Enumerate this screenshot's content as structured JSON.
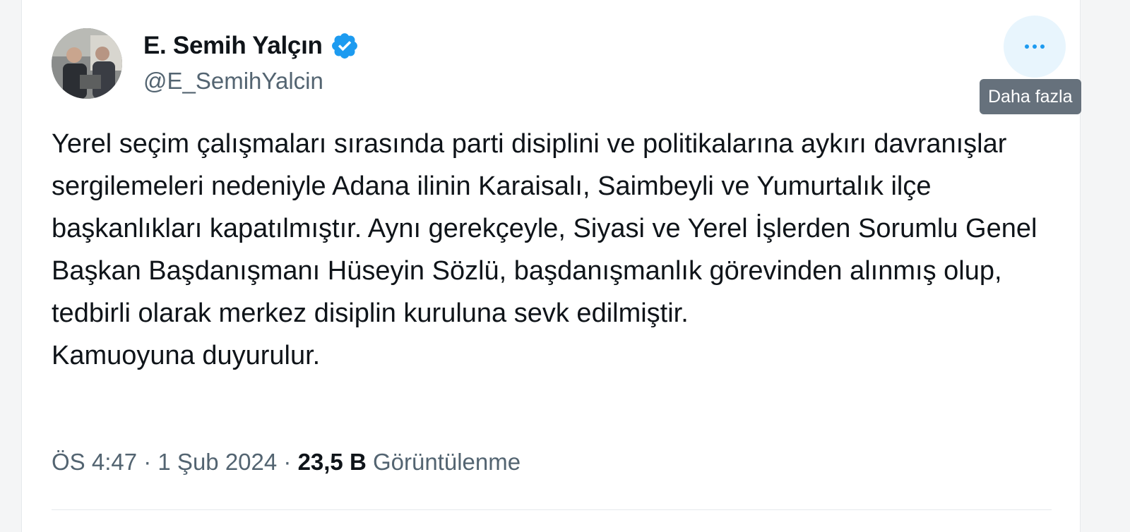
{
  "author": {
    "display_name": "E. Semih Yalçın",
    "handle": "@E_SemihYalcin",
    "verified_icon": "verified-badge-icon",
    "verified_color": "#1d9bf0"
  },
  "more_button": {
    "icon": "more-horizontal-icon",
    "tooltip": "Daha fazla"
  },
  "tweet": {
    "paragraphs": [
      "Yerel seçim çalışmaları sırasında parti disiplini ve politikalarına aykırı davranışlar sergilemeleri nedeniyle Adana ilinin Karaisalı, Saimbeyli ve Yumurtalık ilçe başkanlıkları kapatılmıştır. Aynı gerekçeyle, Siyasi ve Yerel İşlerden Sorumlu Genel Başkan Başdanışmanı Hüseyin Sözlü, başdanışmanlık görevinden alınmış olup, tedbirli olarak merkez disiplin kuruluna sevk edilmiştir.",
      "Kamuoyuna duyurulur."
    ]
  },
  "meta": {
    "time": "ÖS 4:47",
    "separator": " · ",
    "date": "1 Şub 2024",
    "views_count": "23,5 B",
    "views_label": "Görüntülenme"
  }
}
